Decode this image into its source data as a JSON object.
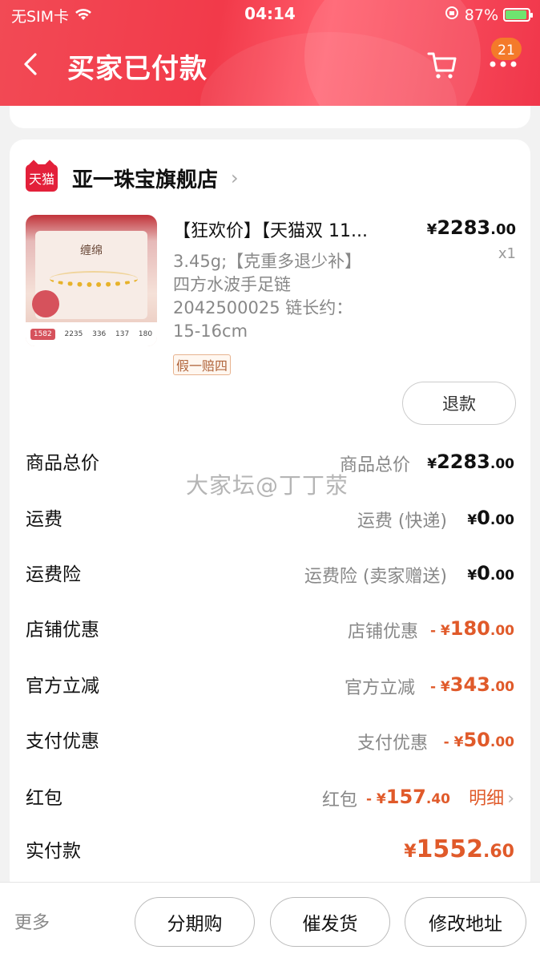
{
  "status_bar": {
    "carrier": "无SIM卡",
    "time": "04:14",
    "battery": "87%"
  },
  "nav": {
    "title": "买家已付款",
    "badge_count": "21"
  },
  "shop": {
    "logo_text": "天猫",
    "name": "亚一珠宝旗舰店"
  },
  "product": {
    "title": "【狂欢价】【天猫双 11...",
    "price_currency": "¥",
    "price_int": "2283",
    "price_dec": ".00",
    "quantity": "x1",
    "spec_lines": [
      "3.45g;【克重多退少补】",
      "四方水波手足链",
      "2042500025 链长约：",
      "15-16cm"
    ],
    "tag": "假一赔四",
    "image": {
      "brand": "缠绵",
      "band_values": [
        "1582",
        "2235",
        "336",
        "137",
        "180"
      ]
    }
  },
  "refund_label": "退款",
  "summary": [
    {
      "label": "商品总价",
      "sub": "商品总价",
      "cur": "¥",
      "int": "2283",
      "dec": ".00",
      "negative": false
    },
    {
      "label": "运费",
      "sub": "运费 (快递)",
      "cur": "¥",
      "int": "0",
      "dec": ".00",
      "negative": false
    },
    {
      "label": "运费险",
      "sub": "运费险 (卖家赠送)",
      "cur": "¥",
      "int": "0",
      "dec": ".00",
      "negative": false
    },
    {
      "label": "店铺优惠",
      "sub": "店铺优惠",
      "cur": "- ¥",
      "int": "180",
      "dec": ".00",
      "negative": true
    },
    {
      "label": "官方立减",
      "sub": "官方立减",
      "cur": "- ¥",
      "int": "343",
      "dec": ".00",
      "negative": true
    },
    {
      "label": "支付优惠",
      "sub": "支付优惠",
      "cur": "- ¥",
      "int": "50",
      "dec": ".00",
      "negative": true
    }
  ],
  "red_packet": {
    "label": "红包",
    "sub": "红包",
    "cur": "- ¥",
    "int": "157",
    "dec": ".40",
    "detail": "明细"
  },
  "total": {
    "label": "实付款",
    "cur": "¥",
    "int": "1552",
    "dec": ".60"
  },
  "watermark": "大家坛@丁丁荥",
  "bottom": {
    "more": "更多",
    "installment": "分期购",
    "urge": "催发货",
    "change_address": "修改地址"
  },
  "colors": {
    "header": "#f24a55",
    "accent": "#e05a2a",
    "badge": "#f47a2a"
  },
  "icons": [
    "wifi-icon",
    "back-icon",
    "cart-icon",
    "more-dots-icon",
    "chevron-right-icon"
  ]
}
